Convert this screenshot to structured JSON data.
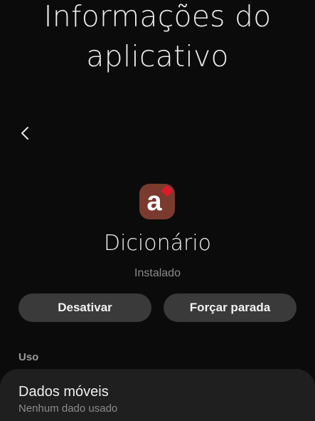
{
  "header": {
    "title_line1": "Informações do",
    "title_line2": "aplicativo",
    "back_icon": "chevron-left-icon"
  },
  "app": {
    "icon_letter": "a",
    "icon_bg_color": "#7a3a2e",
    "icon_accent_color": "#e0192a",
    "name": "Dicionário",
    "status": "Instalado"
  },
  "actions": {
    "disable_label": "Desativar",
    "force_stop_label": "Forçar parada"
  },
  "usage": {
    "section_label": "Uso",
    "items": [
      {
        "title": "Dados móveis",
        "subtitle": "Nenhum dado usado"
      }
    ]
  }
}
